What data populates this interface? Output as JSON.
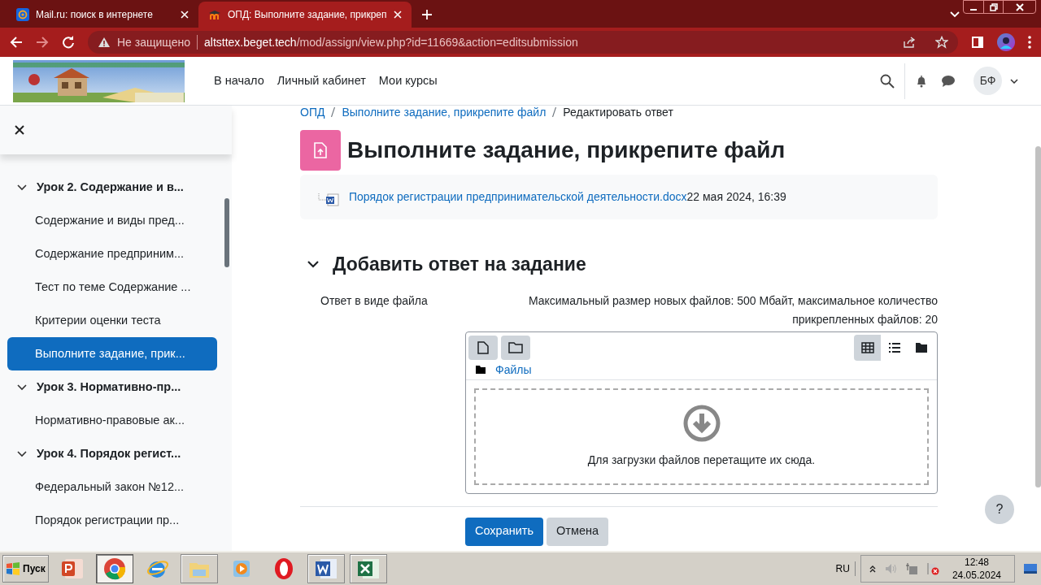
{
  "browser": {
    "tabs": [
      {
        "title": "Mail.ru: поиск в интернете",
        "kind": "mail",
        "selected": false
      },
      {
        "title": "ОПД: Выполните задание, прикреп",
        "kind": "moodle",
        "selected": true
      }
    ],
    "address": {
      "security": "Не защищено",
      "host": "altsttex.beget.tech",
      "path": "/mod/assign/view.php?id=11669&action=editsubmission"
    }
  },
  "header": {
    "nav": [
      "В начало",
      "Личный кабинет",
      "Мои курсы"
    ],
    "avatar": "БФ"
  },
  "sidebar": {
    "sections": [
      {
        "title": "Урок 2. Содержание и в...",
        "expanded": true,
        "children": [
          {
            "label": "Содержание и виды пред...",
            "selected": false
          },
          {
            "label": "Содержание предприним...",
            "selected": false
          },
          {
            "label": "Тест по теме Содержание ...",
            "selected": false
          },
          {
            "label": "Критерии оценки теста",
            "selected": false
          },
          {
            "label": "Выполните задание, прик...",
            "selected": true
          }
        ]
      },
      {
        "title": "Урок 3. Нормативно-пр...",
        "expanded": true,
        "children": [
          {
            "label": "Нормативно-правовые ак...",
            "selected": false
          }
        ]
      },
      {
        "title": "Урок 4. Порядок регист...",
        "expanded": true,
        "children": [
          {
            "label": "Федеральный закон №12...",
            "selected": false
          },
          {
            "label": "Порядок регистрации пр...",
            "selected": false
          }
        ]
      }
    ]
  },
  "breadcrumb": [
    {
      "label": "ОПД",
      "link": true
    },
    {
      "label": "Выполните задание, прикрепите файл",
      "link": true
    },
    {
      "label": "Редактировать ответ",
      "link": false
    }
  ],
  "title": "Выполните задание, прикрепите файл",
  "intro_file": {
    "name": "Порядок регистрации предпринимательской деятельности.docx",
    "date": "22 мая 2024, 16:39"
  },
  "section": {
    "title": "Добавить ответ на задание",
    "expanded": true
  },
  "field": {
    "label": "Ответ в виде файла",
    "limits": "Максимальный размер новых файлов: 500 Мбайт, максимальное количество прикрепленных файлов: 20",
    "path": "Файлы",
    "dropzone": "Для загрузки файлов перетащите их сюда.",
    "views": [
      {
        "kind": "icons",
        "selected": true
      },
      {
        "kind": "list",
        "selected": false
      },
      {
        "kind": "tree",
        "selected": false
      }
    ]
  },
  "buttons": [
    {
      "label": "Сохранить",
      "kind": "primary"
    },
    {
      "label": "Отмена",
      "kind": "secondary"
    }
  ],
  "help": "?",
  "taskbar": {
    "start": "Пуск",
    "apps": [
      {
        "kind": "powerpoint",
        "running": false,
        "selected": false
      },
      {
        "kind": "chrome",
        "running": true,
        "selected": true
      },
      {
        "kind": "ie",
        "running": false,
        "selected": false
      },
      {
        "kind": "explorer",
        "running": true,
        "selected": false
      },
      {
        "kind": "media",
        "running": false,
        "selected": false
      },
      {
        "kind": "opera",
        "running": false,
        "selected": false
      },
      {
        "kind": "word",
        "running": true,
        "selected": false
      },
      {
        "kind": "excel",
        "running": true,
        "selected": false
      }
    ],
    "language": "RU",
    "time": "12:48",
    "date": "24.05.2024"
  }
}
